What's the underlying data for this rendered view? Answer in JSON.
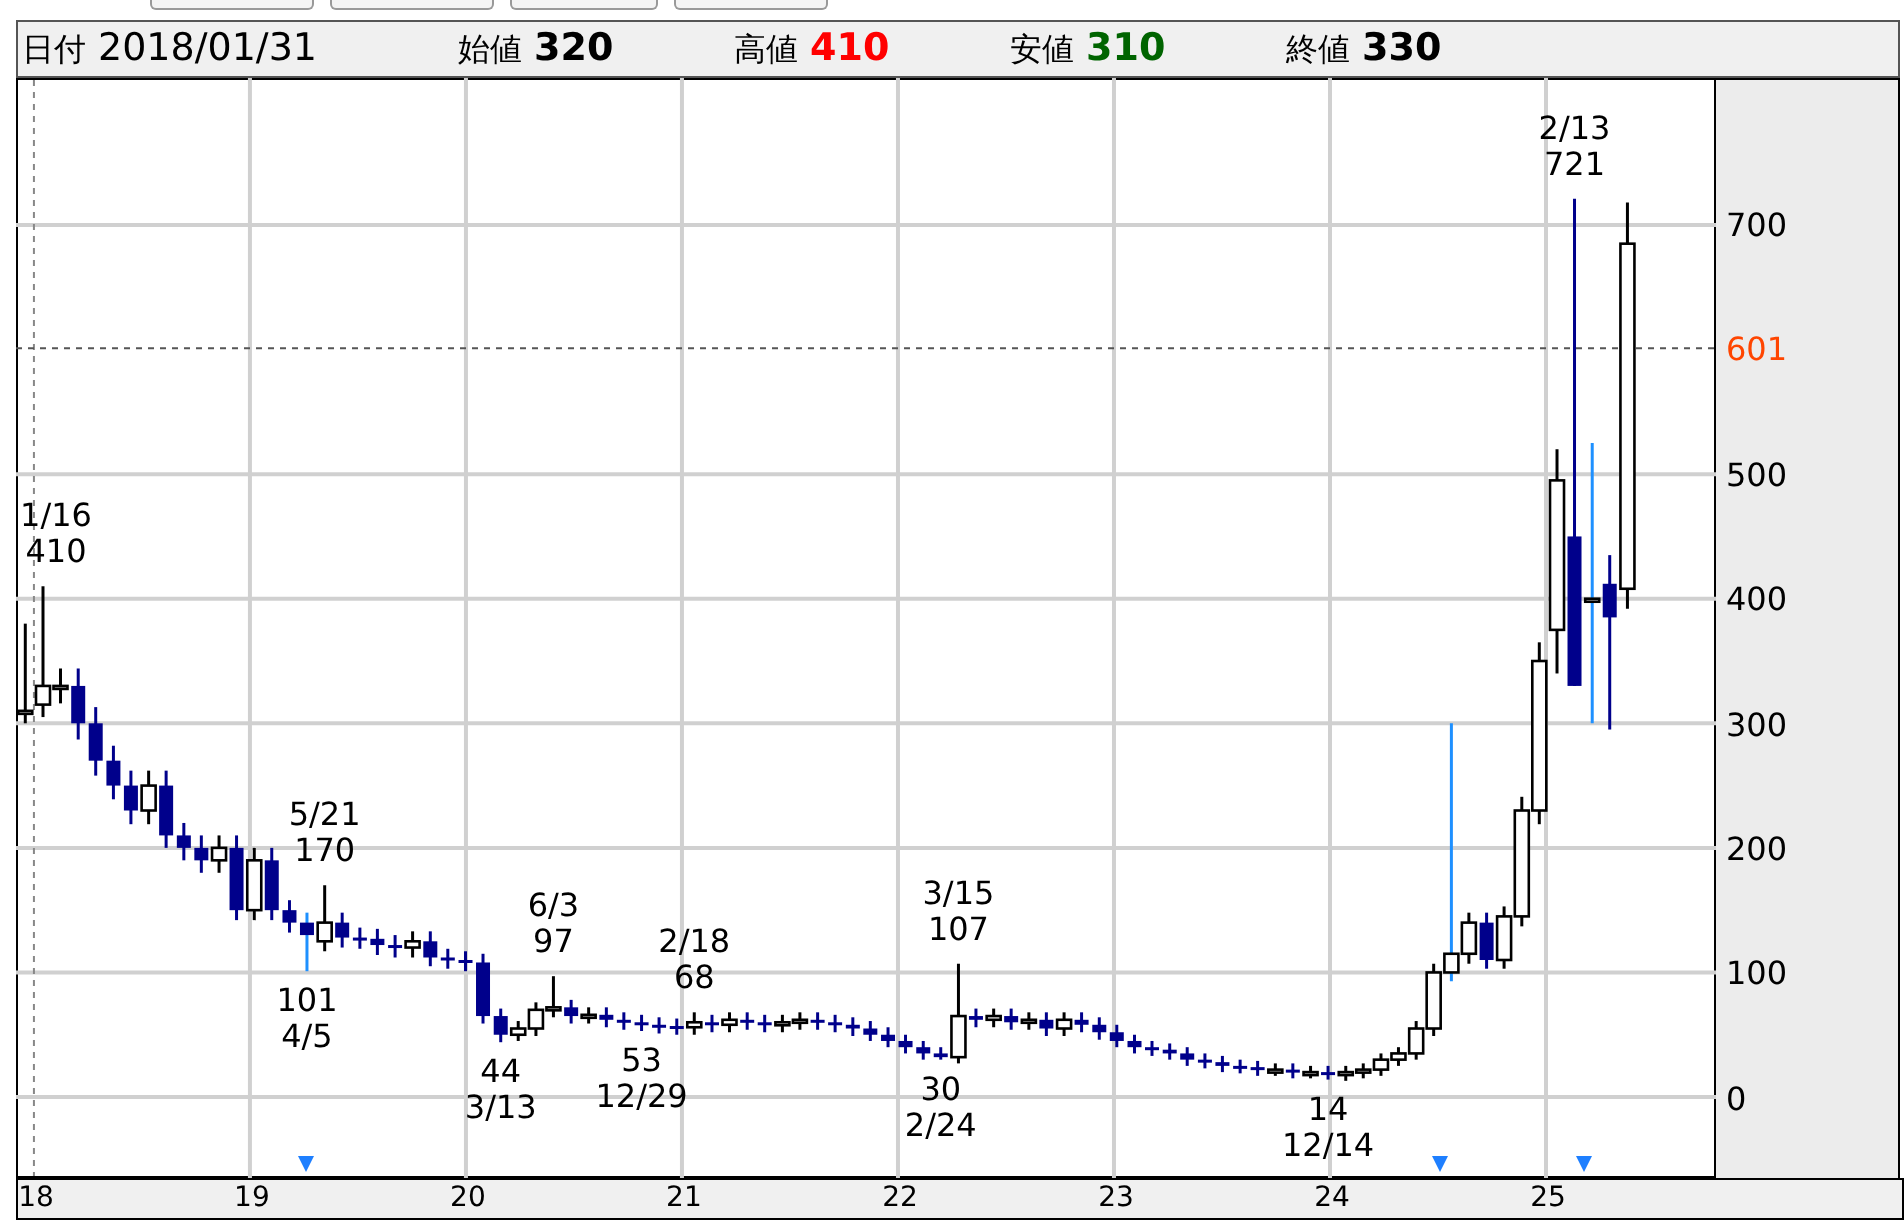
{
  "header": [
    {
      "kind": "date",
      "label": "日付",
      "value": "2018/01/31"
    },
    {
      "kind": "price",
      "label": "始値",
      "value": "320",
      "color": "#000000"
    },
    {
      "kind": "price",
      "label": "高値",
      "value": "410",
      "color": "#ff0000"
    },
    {
      "kind": "price",
      "label": "安値",
      "value": "310",
      "color": "#006400"
    },
    {
      "kind": "price",
      "label": "終値",
      "value": "330",
      "color": "#000000"
    }
  ],
  "chart": {
    "chart_data": {
      "type": "candlestick",
      "x": [
        17.96,
        18.042,
        18.123,
        18.205,
        18.286,
        18.368,
        18.449,
        18.531,
        18.612,
        18.694,
        18.775,
        18.857,
        18.938,
        19.02,
        19.101,
        19.183,
        19.264,
        19.346,
        19.427,
        19.509,
        19.59,
        19.672,
        19.753,
        19.835,
        19.916,
        19.998,
        20.079,
        20.161,
        20.242,
        20.324,
        20.405,
        20.487,
        20.568,
        20.65,
        20.731,
        20.813,
        20.894,
        20.976,
        21.057,
        21.139,
        21.22,
        21.302,
        21.383,
        21.465,
        21.546,
        21.628,
        21.709,
        21.791,
        21.872,
        21.954,
        22.035,
        22.117,
        22.198,
        22.28,
        22.361,
        22.443,
        22.524,
        22.606,
        22.687,
        22.769,
        22.85,
        22.932,
        23.013,
        23.095,
        23.176,
        23.258,
        23.339,
        23.421,
        23.502,
        23.584,
        23.665,
        23.747,
        23.828,
        23.91,
        23.991,
        24.073,
        24.154,
        24.236,
        24.317,
        24.399,
        24.48,
        24.562,
        24.643,
        24.725,
        24.806,
        24.888,
        24.969,
        25.051,
        25.132,
        25.214,
        25.295,
        25.377
      ],
      "ohlc": [
        [
          310,
          380,
          300,
          310
        ],
        [
          315,
          410,
          305,
          330
        ],
        [
          330,
          344,
          316,
          330
        ],
        [
          330,
          344,
          287,
          300
        ],
        [
          300,
          313,
          258,
          270
        ],
        [
          270,
          282,
          239,
          250
        ],
        [
          250,
          262,
          219,
          230
        ],
        [
          230,
          262,
          219,
          250
        ],
        [
          250,
          262,
          200,
          210
        ],
        [
          210,
          220,
          190,
          200
        ],
        [
          200,
          210,
          180,
          190
        ],
        [
          190,
          210,
          180,
          200
        ],
        [
          200,
          210,
          142,
          150
        ],
        [
          150,
          200,
          142,
          190
        ],
        [
          190,
          200,
          142,
          150
        ],
        [
          150,
          158,
          132,
          140
        ],
        [
          140,
          148,
          101,
          130
        ],
        [
          125,
          170,
          117,
          140
        ],
        [
          140,
          148,
          120,
          128
        ],
        [
          128,
          136,
          119,
          127
        ],
        [
          127,
          135,
          114,
          122
        ],
        [
          122,
          130,
          112,
          120
        ],
        [
          120,
          133,
          112,
          125
        ],
        [
          125,
          133,
          105,
          112
        ],
        [
          112,
          119,
          103,
          110
        ],
        [
          110,
          117,
          101,
          108
        ],
        [
          108,
          115,
          59,
          65
        ],
        [
          65,
          71,
          44,
          50
        ],
        [
          50,
          61,
          45,
          55
        ],
        [
          55,
          76,
          49,
          70
        ],
        [
          70,
          97,
          64,
          72
        ],
        [
          72,
          78,
          59,
          65
        ],
        [
          65,
          72,
          59,
          66
        ],
        [
          66,
          72,
          56,
          62
        ],
        [
          62,
          68,
          54,
          60
        ],
        [
          60,
          66,
          53,
          58
        ],
        [
          58,
          64,
          51,
          57
        ],
        [
          57,
          63,
          50,
          56
        ],
        [
          56,
          68,
          50,
          60
        ],
        [
          60,
          66,
          52,
          58
        ],
        [
          58,
          68,
          52,
          62
        ],
        [
          62,
          68,
          54,
          60
        ],
        [
          60,
          66,
          52,
          58
        ],
        [
          58,
          66,
          52,
          60
        ],
        [
          60,
          68,
          54,
          62
        ],
        [
          62,
          68,
          54,
          60
        ],
        [
          60,
          66,
          52,
          58
        ],
        [
          58,
          64,
          49,
          55
        ],
        [
          55,
          61,
          45,
          50
        ],
        [
          50,
          56,
          40,
          45
        ],
        [
          45,
          50,
          35,
          40
        ],
        [
          40,
          45,
          30,
          35
        ],
        [
          35,
          40,
          30,
          32
        ],
        [
          32,
          107,
          27,
          65
        ],
        [
          65,
          71,
          56,
          62
        ],
        [
          62,
          71,
          56,
          65
        ],
        [
          65,
          71,
          54,
          60
        ],
        [
          60,
          68,
          54,
          62
        ],
        [
          62,
          68,
          49,
          55
        ],
        [
          55,
          68,
          49,
          62
        ],
        [
          62,
          68,
          52,
          58
        ],
        [
          58,
          64,
          46,
          52
        ],
        [
          52,
          58,
          40,
          45
        ],
        [
          45,
          50,
          35,
          40
        ],
        [
          40,
          45,
          33,
          38
        ],
        [
          38,
          43,
          30,
          35
        ],
        [
          35,
          40,
          25,
          30
        ],
        [
          30,
          35,
          23,
          28
        ],
        [
          28,
          33,
          20,
          25
        ],
        [
          25,
          30,
          19,
          24
        ],
        [
          24,
          29,
          17,
          22
        ],
        [
          22,
          27,
          17,
          22
        ],
        [
          22,
          27,
          15,
          20
        ],
        [
          20,
          25,
          15,
          20
        ],
        [
          20,
          25,
          14,
          18
        ],
        [
          18,
          25,
          13,
          20
        ],
        [
          20,
          27,
          15,
          22
        ],
        [
          22,
          35,
          17,
          30
        ],
        [
          30,
          40,
          25,
          35
        ],
        [
          35,
          61,
          30,
          55
        ],
        [
          55,
          107,
          49,
          100
        ],
        [
          100,
          300,
          93,
          115
        ],
        [
          115,
          148,
          107,
          140
        ],
        [
          140,
          148,
          103,
          110
        ],
        [
          110,
          153,
          103,
          145
        ],
        [
          145,
          241,
          137,
          230
        ],
        [
          230,
          365,
          219,
          350
        ],
        [
          375,
          520,
          340,
          495
        ],
        [
          450,
          721,
          330,
          330
        ],
        [
          400,
          525,
          300,
          400
        ],
        [
          412,
          435,
          295,
          385
        ],
        [
          408,
          718,
          392,
          685
        ]
      ],
      "xlim": [
        17.917,
        25.787
      ],
      "ylim": [
        -65,
        818
      ],
      "grid": true,
      "yticks": [
        {
          "value": 700,
          "label": "700"
        },
        {
          "value": 500,
          "label": "500"
        },
        {
          "value": 400,
          "label": "400"
        },
        {
          "value": 300,
          "label": "300"
        },
        {
          "value": 200,
          "label": "200"
        },
        {
          "value": 100,
          "label": "100"
        },
        {
          "value": 0,
          "label": "0"
        }
      ],
      "xticks": [
        18,
        19,
        20,
        21,
        22,
        23,
        24,
        25
      ],
      "ref_lines": [
        {
          "axis": "x",
          "value": 18
        },
        {
          "axis": "y",
          "value": 601,
          "label": "601"
        }
      ]
    },
    "price_labels": [
      {
        "kind": "high",
        "date": "1/16",
        "price": "410"
      },
      {
        "kind": "low",
        "price": "101",
        "date": "4/5"
      },
      {
        "kind": "high",
        "date": "5/21",
        "price": "170"
      },
      {
        "kind": "high",
        "date": "6/3",
        "price": "97"
      },
      {
        "kind": "low",
        "price": "44",
        "date": "3/13"
      },
      {
        "kind": "high",
        "date": "2/18",
        "price": "68"
      },
      {
        "kind": "low",
        "price": "53",
        "date": "12/29"
      },
      {
        "kind": "high",
        "date": "3/15",
        "price": "107"
      },
      {
        "kind": "low",
        "price": "30",
        "date": "2/24"
      },
      {
        "kind": "low",
        "price": "14",
        "date": "12/14"
      },
      {
        "kind": "high",
        "date": "2/13",
        "price": "721"
      }
    ]
  }
}
